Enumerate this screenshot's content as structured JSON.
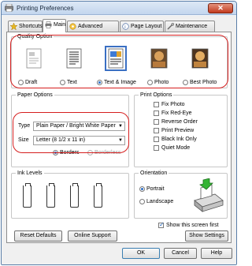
{
  "window": {
    "title": "Printing Preferences",
    "close_label": "✕"
  },
  "tabs": [
    {
      "label": "Shortcuts",
      "icon": "shortcuts-icon"
    },
    {
      "label": "Main",
      "icon": "main-printer-icon"
    },
    {
      "label": "Advanced",
      "icon": "advanced-icon"
    },
    {
      "label": "Page Layout",
      "icon": "page-layout-icon"
    },
    {
      "label": "Maintenance",
      "icon": "maintenance-icon"
    }
  ],
  "quality": {
    "title": "Quality Option",
    "options": [
      {
        "label": "Draft",
        "selected": false
      },
      {
        "label": "Text",
        "selected": false
      },
      {
        "label": "Text & Image",
        "selected": true
      },
      {
        "label": "Photo",
        "selected": false
      },
      {
        "label": "Best Photo",
        "selected": false
      }
    ]
  },
  "paper": {
    "title": "Paper Options",
    "type_label": "Type",
    "type_value": "Plain Paper / Bright White Paper",
    "size_label": "Size",
    "size_value": "Letter (8 1/2 x 11 in)",
    "borders_label": "Borders",
    "borderless_label": "Borderless",
    "borders_selected": true
  },
  "print_options": {
    "title": "Print Options",
    "items": [
      {
        "label": "Fix Photo",
        "checked": false
      },
      {
        "label": "Fix Red-Eye",
        "checked": false
      },
      {
        "label": "Reverse Order",
        "checked": false
      },
      {
        "label": "Print Preview",
        "checked": false
      },
      {
        "label": "Black Ink Only",
        "checked": false
      },
      {
        "label": "Quiet Mode",
        "checked": false
      }
    ]
  },
  "ink": {
    "title": "Ink Levels"
  },
  "orientation": {
    "title": "Orientation",
    "portrait_label": "Portrait",
    "landscape_label": "Landscape",
    "portrait_selected": true
  },
  "show_screen": {
    "label": "Show this screen first",
    "checked": true
  },
  "buttons": {
    "reset_defaults": "Reset Defaults",
    "online_support": "Online Support",
    "show_settings": "Show Settings",
    "ok": "OK",
    "cancel": "Cancel",
    "help": "Help"
  },
  "colors": {
    "highlight_outline": "#d61f1f",
    "accent": "#2c6fc8",
    "title_bar": "#c3d6ee"
  }
}
